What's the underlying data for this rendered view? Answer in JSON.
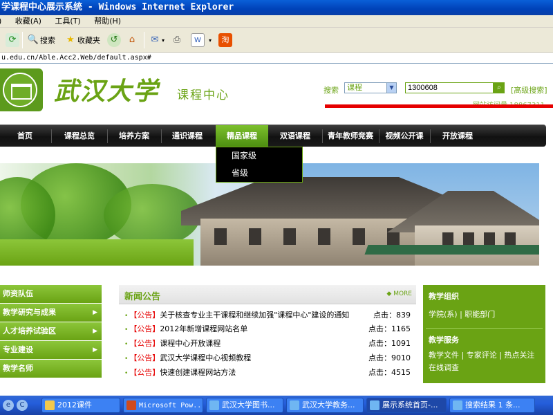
{
  "window": {
    "title": "学课程中心展示系统 - Windows Internet Explorer"
  },
  "menubar": {
    "items": [
      "收藏(A)",
      "工具(T)",
      "帮助(H)"
    ]
  },
  "toolbar": {
    "search_label": "搜索",
    "favorites_label": "收藏夹"
  },
  "address": {
    "url": "u.edu.cn/Able.Acc2.Web/default.aspx#"
  },
  "header": {
    "university": "武汉大学",
    "site_name": "课程中心",
    "search_label": "搜索",
    "search_scope": "课程",
    "search_value": "1300608",
    "advanced_search": "[高级搜索]",
    "visits": "网站访问量 18867311"
  },
  "nav": {
    "items": [
      "首页",
      "课程总览",
      "培养方案",
      "通识课程",
      "精品课程",
      "双语课程",
      "青年教师竞赛",
      "视频公开课",
      "开放课程"
    ],
    "active_index": 4
  },
  "dropdown": {
    "items": [
      "国家级",
      "省级"
    ]
  },
  "leftnav": {
    "items": [
      {
        "label": "师资队伍",
        "arrow": false
      },
      {
        "label": "教学研究与成果",
        "arrow": true
      },
      {
        "label": "人才培养试验区",
        "arrow": true
      },
      {
        "label": "专业建设",
        "arrow": true
      },
      {
        "label": "教学名师",
        "arrow": false
      }
    ]
  },
  "news": {
    "title": "新闻公告",
    "more": "MORE",
    "items": [
      {
        "tag": "【公告】",
        "text": "关于核查专业主干课程和继续加强\"课程中心\"建设的通知",
        "hits": "点击：839"
      },
      {
        "tag": "【公告】",
        "text": "2012年新增课程网站名单",
        "hits": "点击：1165"
      },
      {
        "tag": "【公告】",
        "text": "课程中心开放课程",
        "hits": "点击：1091"
      },
      {
        "tag": "【公告】",
        "text": "武汉大学课程中心视频教程",
        "hits": "点击：9010"
      },
      {
        "tag": "【公告】",
        "text": "快速创建课程网站方法",
        "hits": "点击：4515"
      }
    ]
  },
  "rightnav": {
    "org_title": "教学组织",
    "org_links": "学院(系) | 职能部门",
    "service_title": "教学服务",
    "service_links": "教学文件 | 专家评论 | 热点关注",
    "service_links2": "在线调查"
  },
  "taskbar": {
    "tasks": [
      "2012课件",
      "Microsoft Pow...",
      "武汉大学图书...",
      "武汉大学教务...",
      "展示系统首页-...",
      "搜索结果 1 条..."
    ],
    "active_index": 4
  },
  "colors": {
    "brand_green": "#6aa314",
    "red_accent": "#e60000",
    "xp_blue": "#245edb"
  }
}
